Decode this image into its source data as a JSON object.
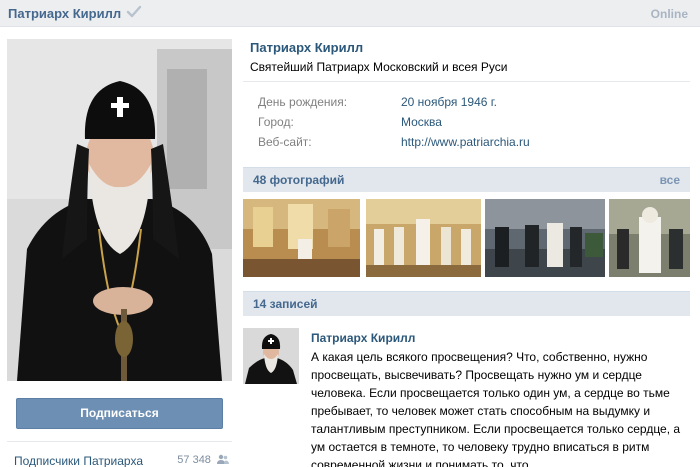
{
  "header": {
    "name": "Патриарх Кирилл",
    "status": "Online"
  },
  "profile": {
    "title": "Патриарх Кирилл",
    "status_line": "Святейший Патриарх Московский и всея Руси",
    "info": [
      {
        "label": "День рождения:",
        "value": "20 ноября 1946 г."
      },
      {
        "label": "Город:",
        "value": "Москва"
      },
      {
        "label": "Веб-сайт:",
        "value": "http://www.patriarchia.ru"
      }
    ]
  },
  "sidebar": {
    "subscribe_label": "Подписаться",
    "subscribers_label": "Подписчики Патриарха",
    "subscribers_count": "57 348"
  },
  "photos": {
    "heading": "48 фотографий",
    "all_label": "все"
  },
  "wall": {
    "heading": "14 записей",
    "post": {
      "author": "Патриарх Кирилл",
      "text": "А какая цель всякого просвещения? Что, собственно, нужно просвещать, высвечивать? Просвещать нужно ум и сердце человека. Если просвещается только один ум, а сердце во тьме пребывает, то человек может стать способным на выдумку и талантливым преступником. Если просвещается только сердце, а ум остается в темноте, то человеку трудно вписаться в ритм современной жизни и понимать то, что"
    }
  },
  "colors": {
    "link": "#2b587a",
    "header_bg": "#edeef0",
    "section_bg": "#e1e7ed",
    "button": "#6d8fb3"
  },
  "icons": [
    "verified-check-icon",
    "people-icon"
  ]
}
